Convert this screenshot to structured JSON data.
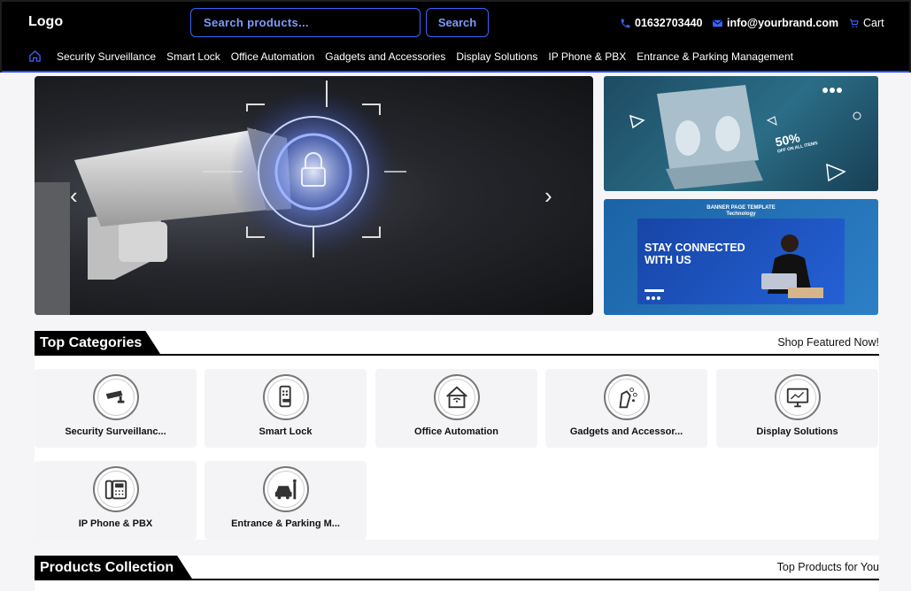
{
  "header": {
    "logo": "Logo",
    "search_placeholder": "Search products...",
    "search_button": "Search",
    "phone": "01632703440",
    "email": "info@yourbrand.com",
    "cart": "Cart",
    "accent_color": "#3b63ff"
  },
  "nav": {
    "items": [
      "Security Surveillance",
      "Smart Lock",
      "Office Automation",
      "Gadgets and Accessories",
      "Display Solutions",
      "IP Phone & PBX",
      "Entrance & Parking Management"
    ]
  },
  "banners": {
    "offer": "50%",
    "offer_sub": "OFF ON ALL ITEMS",
    "banner2_top1": "BANNER PAGE TEMPLATE",
    "banner2_top2": "Technology",
    "banner2_headline": "STAY CONNECTED WITH US"
  },
  "categories": {
    "title": "Top Categories",
    "subtitle": "Shop Featured Now!",
    "items": [
      {
        "label": "Security Surveillanc...",
        "icon": "cctv-camera-icon"
      },
      {
        "label": "Smart Lock",
        "icon": "smart-lock-icon"
      },
      {
        "label": "Office Automation",
        "icon": "smart-home-icon"
      },
      {
        "label": "Gadgets and Accessor...",
        "icon": "gadgets-icon"
      },
      {
        "label": "Display Solutions",
        "icon": "display-icon"
      },
      {
        "label": "IP Phone & PBX",
        "icon": "ip-phone-icon"
      },
      {
        "label": "Entrance & Parking M...",
        "icon": "parking-icon"
      }
    ]
  },
  "products": {
    "title": "Products Collection",
    "subtitle": "Top Products for You"
  }
}
